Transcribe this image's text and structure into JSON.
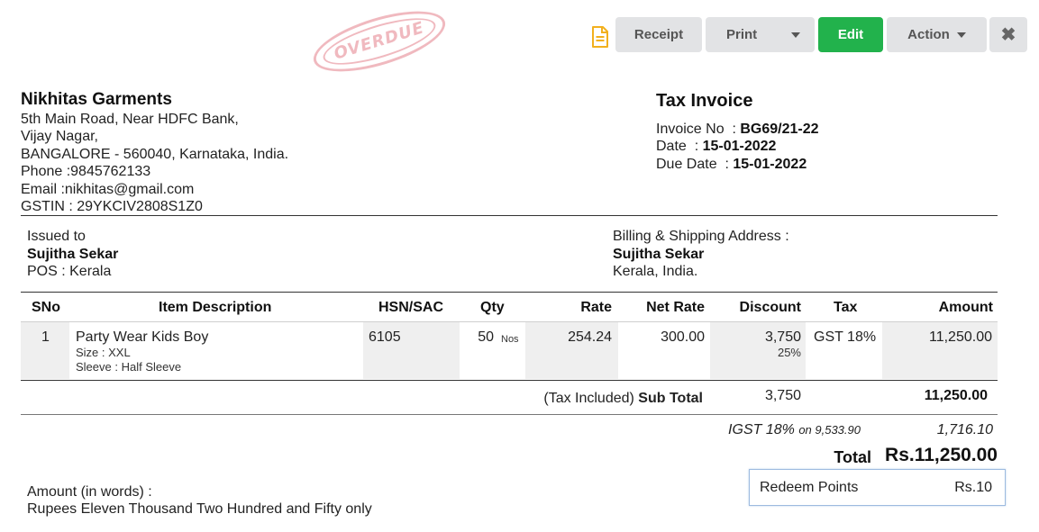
{
  "stamp": {
    "text": "OVERDUE",
    "color": "#f0b9bf"
  },
  "toolbar": {
    "doc_icon": "document-icon",
    "receipt_label": "Receipt",
    "print_label": "Print",
    "edit_label": "Edit",
    "action_label": "Action",
    "close_symbol": "✖",
    "edit_color": "#22b24c"
  },
  "company": {
    "name": "Nikhitas Garments",
    "address": [
      "5th Main Road, Near HDFC Bank,",
      "Vijay Nagar,",
      "BANGALORE - 560040, Karnataka, India."
    ],
    "phone": "Phone :9845762133",
    "email": "Email :nikhitas@gmail.com",
    "gstin": "GSTIN : 29YKCIV2808S1Z0"
  },
  "invoice": {
    "title": "Tax Invoice",
    "number_label": "Invoice No  : ",
    "number": "BG69/21-22",
    "date_label": "Date  : ",
    "date": "15-01-2022",
    "due_label": "Due Date  : ",
    "due": "15-01-2022"
  },
  "issued_to": {
    "label": "Issued to",
    "name": "Sujitha Sekar",
    "pos": "POS : Kerala"
  },
  "billing": {
    "label": "Billing & Shipping Address :",
    "name": "Sujitha Sekar",
    "address": "Kerala, India."
  },
  "table": {
    "headers": [
      "SNo",
      "Item Description",
      "HSN/SAC",
      "Qty",
      "Rate",
      "Net Rate",
      "Discount",
      "Tax",
      "Amount"
    ],
    "rows": [
      {
        "sno": "1",
        "description": "Party Wear Kids Boy",
        "attr1": "Size : XXL",
        "attr2": "Sleeve : Half Sleeve",
        "hsn": "6105",
        "qty": "50",
        "unit": "Nos",
        "rate": "254.24",
        "net_rate": "300.00",
        "discount": "3,750",
        "discount_pct": "25%",
        "tax": "GST 18%",
        "amount": "11,250.00"
      }
    ]
  },
  "totals": {
    "subtotal_prefix": "(Tax Included) ",
    "subtotal_label": "Sub Total",
    "subtotal_discount": "3,750",
    "subtotal_amount": "11,250.00",
    "igst_label": "IGST 18%",
    "igst_on": "on 9,533.90",
    "igst_amount": "1,716.10",
    "total_label": "Total",
    "total_amount": "Rs.11,250.00"
  },
  "redeem": {
    "label": "Redeem Points",
    "value": "Rs.10"
  },
  "amount_words": {
    "label": "Amount (in words) :",
    "value": "Rupees Eleven Thousand Two Hundred and Fifty only"
  }
}
